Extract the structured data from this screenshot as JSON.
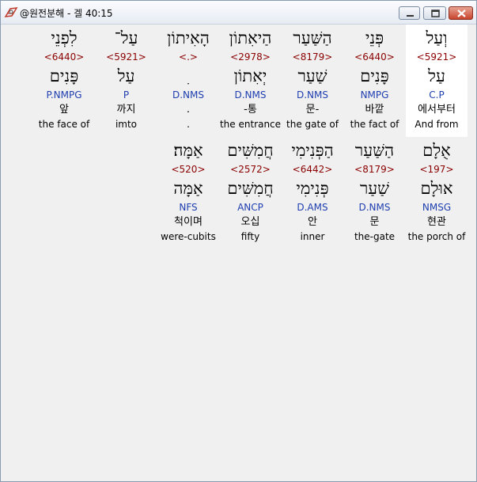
{
  "window": {
    "title": "@원전분해 - 겔 40:15"
  },
  "rows": [
    {
      "words": [
        {
          "heb": "וְעַל",
          "strong": "<5921>",
          "root": "עַל",
          "morph": "C.P",
          "kor": "에서부터",
          "eng": "And from",
          "highlight": true
        },
        {
          "heb": "פְּנֵי",
          "strong": "<6440>",
          "root": "פָּנִים",
          "morph": "NMPG",
          "kor": "바깥",
          "eng": "the fact of",
          "highlight": false
        },
        {
          "heb": "הַשַּׁעַר",
          "strong": "<8179>",
          "root": "שַׁעַר",
          "morph": "D.NMS",
          "kor": "문-",
          "eng": "the gate of",
          "highlight": false
        },
        {
          "heb": "הַיאִתוֹן",
          "strong": "<2978>",
          "root": "יְאִתוֹן",
          "morph": "D.NMS",
          "kor": "-통",
          "eng": "the entrance",
          "highlight": false
        },
        {
          "heb": "הָאִיתוֹן",
          "strong": "<.>",
          "root": "ִ",
          "morph": "D.NMS",
          "kor": ".",
          "eng": ".",
          "highlight": false
        },
        {
          "heb": "עַל־",
          "strong": "<5921>",
          "root": "עַל",
          "morph": "P",
          "kor": "까지",
          "eng": "imto",
          "highlight": false
        },
        {
          "heb": "לִפְנֵי",
          "strong": "<6440>",
          "root": "פָּנִים",
          "morph": "P.NMPG",
          "kor": "앞",
          "eng": "the face of",
          "highlight": false
        }
      ]
    },
    {
      "words": [
        {
          "heb": "אֻלָם",
          "strong": "<197>",
          "root": "אוּלָם",
          "morph": "NMSG",
          "kor": "현관",
          "eng": "the porch of",
          "highlight": false
        },
        {
          "heb": "הַשַּׁעַר",
          "strong": "<8179>",
          "root": "שַׁעַר",
          "morph": "D.NMS",
          "kor": "문",
          "eng": "the-gate",
          "highlight": false
        },
        {
          "heb": "הַפְּנִימִי",
          "strong": "<6442>",
          "root": "פְּנִימִי",
          "morph": "D.AMS",
          "kor": "안",
          "eng": "inner",
          "highlight": false
        },
        {
          "heb": "חֲמִשִּׁים",
          "strong": "<2572>",
          "root": "חֲמִשִּׁים",
          "morph": "ANCP",
          "kor": "오십",
          "eng": "fifty",
          "highlight": false
        },
        {
          "heb": "אַמָּה׃",
          "strong": "<520>",
          "root": "אַמָּה",
          "morph": "NFS",
          "kor": "척이며",
          "eng": "were-cubits",
          "highlight": false
        }
      ]
    }
  ]
}
